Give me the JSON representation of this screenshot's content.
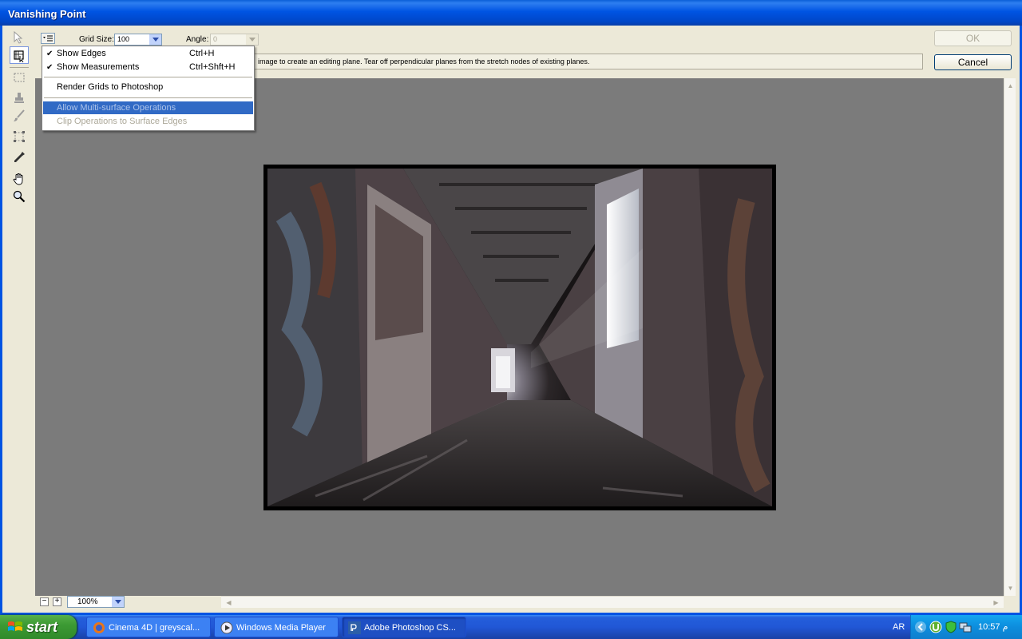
{
  "window": {
    "title": "Vanishing Point"
  },
  "options": {
    "grid_size_label": "Grid Size:",
    "grid_size_value": "100",
    "angle_label": "Angle:",
    "angle_value": "0"
  },
  "buttons": {
    "ok": "OK",
    "cancel": "Cancel"
  },
  "info_text": "image to create an editing plane. Tear off perpendicular planes from the stretch nodes of existing planes.",
  "menu": {
    "items": [
      {
        "label": "Show Edges",
        "shortcut": "Ctrl+H",
        "checked": "✔"
      },
      {
        "label": "Show Measurements",
        "shortcut": "Ctrl+Shft+H",
        "checked": "✔"
      },
      {
        "label": "Render Grids to Photoshop"
      },
      {
        "label": "Allow Multi-surface Operations",
        "state": "highlighted-disabled"
      },
      {
        "label": "Clip Operations to Surface Edges",
        "state": "disabled"
      }
    ]
  },
  "zoom": {
    "value": "100%"
  },
  "tools": [
    "edit-plane-tool",
    "create-plane-tool",
    "marquee-tool",
    "stamp-tool",
    "brush-tool",
    "transform-tool",
    "eyedropper-tool",
    "hand-tool",
    "zoom-tool"
  ],
  "taskbar": {
    "start_label": "start",
    "tasks": [
      {
        "label": "Cinema 4D | greyscal...",
        "icon": "firefox-icon"
      },
      {
        "label": "Windows Media Player",
        "icon": "media-player-icon"
      },
      {
        "label": "Adobe Photoshop CS...",
        "icon": "photoshop-icon",
        "active": true
      }
    ],
    "language": "AR",
    "clock": "10:57 م"
  },
  "colors": {
    "titlebar": "#0054e3",
    "highlight": "#316ac5",
    "canvas": "#7b7b7b"
  }
}
